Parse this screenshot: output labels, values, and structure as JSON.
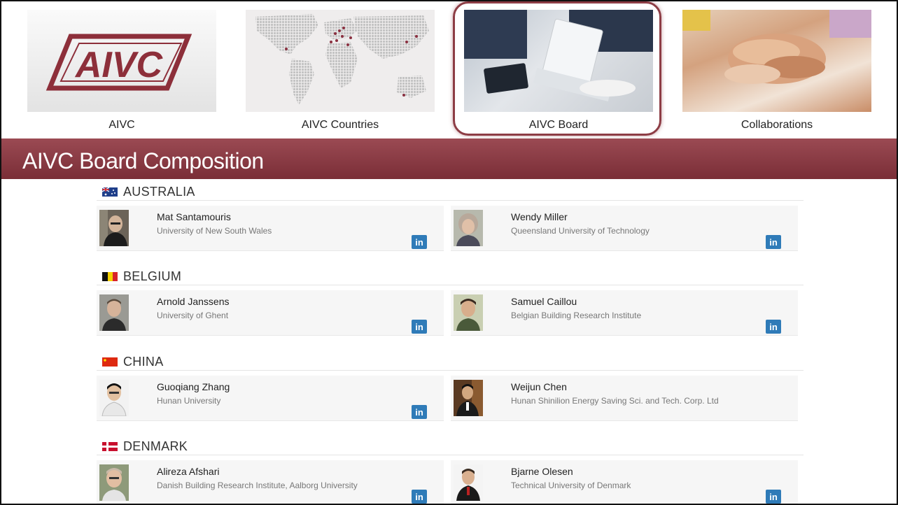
{
  "nav": {
    "items": [
      {
        "label": "AIVC",
        "logo_text": "AIVC"
      },
      {
        "label": "AIVC Countries"
      },
      {
        "label": "AIVC Board"
      },
      {
        "label": "Collaborations"
      }
    ],
    "active_index": 2
  },
  "banner": {
    "title": "AIVC Board Composition"
  },
  "colors": {
    "brand": "#8d3d45",
    "banner": "#8a3b44",
    "linkedin": "#2f7bb8"
  },
  "icons": {
    "linkedin": "in"
  },
  "countries": [
    {
      "name": "AUSTRALIA",
      "members": [
        {
          "name": "Mat Santamouris",
          "org": "University of New South Wales"
        },
        {
          "name": "Wendy Miller",
          "org": "Queensland University of Technology"
        }
      ]
    },
    {
      "name": "BELGIUM",
      "members": [
        {
          "name": "Arnold Janssens",
          "org": "University of Ghent"
        },
        {
          "name": "Samuel Caillou",
          "org": "Belgian Building Research Institute"
        }
      ]
    },
    {
      "name": "CHINA",
      "members": [
        {
          "name": "Guoqiang Zhang",
          "org": "Hunan University"
        },
        {
          "name": "Weijun Chen",
          "org": "Hunan Shinilion Energy Saving Sci. and Tech. Corp. Ltd"
        }
      ]
    },
    {
      "name": "DENMARK",
      "members": [
        {
          "name": "Alireza Afshari",
          "org": "Danish Building Research Institute, Aalborg University"
        },
        {
          "name": "Bjarne Olesen",
          "org": "Technical University of Denmark"
        }
      ]
    }
  ]
}
